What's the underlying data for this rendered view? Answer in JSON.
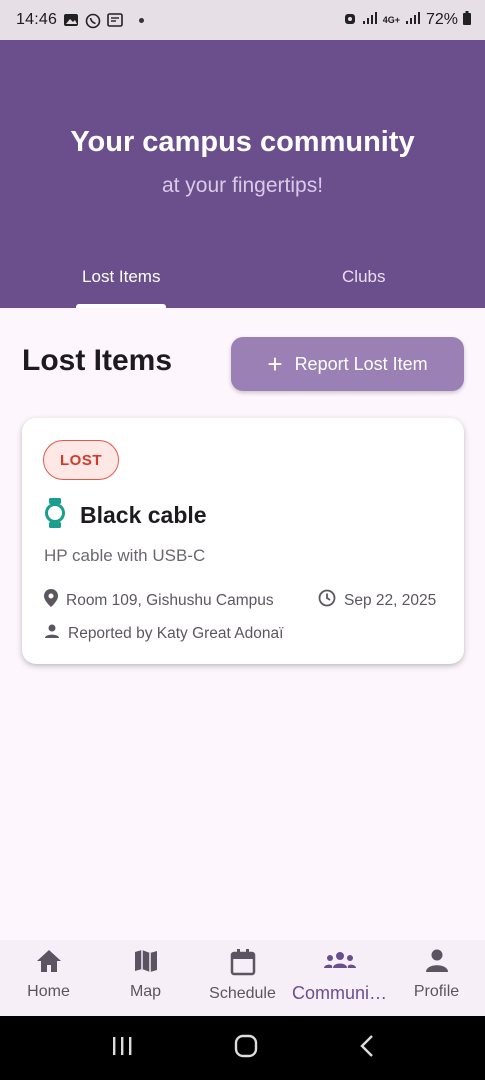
{
  "status_bar": {
    "time": "14:46",
    "battery": "72%",
    "network": "4G+"
  },
  "header": {
    "title": "Your campus community",
    "subtitle": "at your fingertips!",
    "tabs": [
      {
        "label": "Lost Items",
        "active": true
      },
      {
        "label": "Clubs",
        "active": false
      }
    ]
  },
  "main": {
    "section_title": "Lost Items",
    "report_button": "Report Lost Item",
    "items": [
      {
        "status": "LOST",
        "icon": "watch-icon",
        "title": "Black cable",
        "description": "HP cable with USB-C",
        "location": "Room 109, Gishushu Campus",
        "date": "Sep 22, 2025",
        "reported_by": "Reported by Katy Great Adonaï"
      }
    ]
  },
  "bottom_nav": {
    "items": [
      {
        "label": "Home",
        "icon": "home-icon"
      },
      {
        "label": "Map",
        "icon": "map-icon"
      },
      {
        "label": "Schedule",
        "icon": "calendar-icon"
      },
      {
        "label": "Communi…",
        "icon": "groups-icon",
        "active": true
      },
      {
        "label": "Profile",
        "icon": "person-icon"
      }
    ]
  },
  "colors": {
    "primary": "#6b4f8c",
    "button": "#9a80b5",
    "lost_badge": "#d33a2c",
    "item_icon": "#1a9e8f"
  }
}
